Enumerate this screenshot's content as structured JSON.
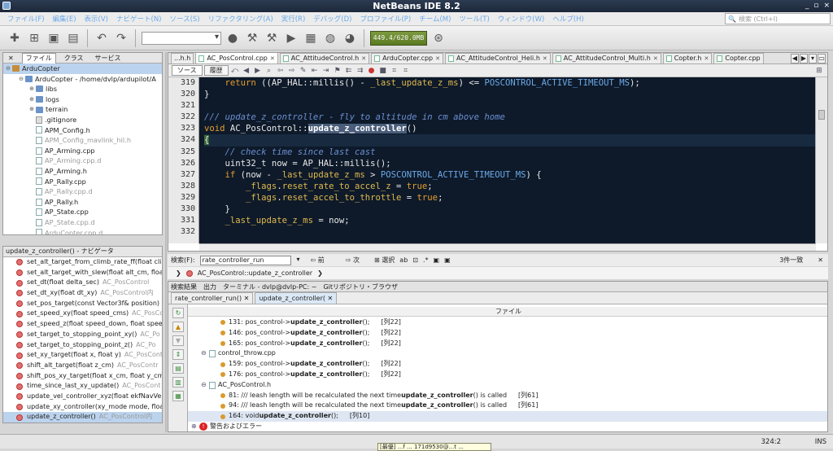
{
  "window": {
    "title": "NetBeans IDE 8.2",
    "controls": [
      "_",
      "▫",
      "×"
    ]
  },
  "menu": {
    "items": [
      "ファイル(F)",
      "編集(E)",
      "表示(V)",
      "ナビゲート(N)",
      "ソース(S)",
      "リファクタリング(A)",
      "実行(R)",
      "デバッグ(D)",
      "プロファイル(P)",
      "チーム(M)",
      "ツール(T)",
      "ウィンドウ(W)",
      "ヘルプ(H)"
    ],
    "search_placeholder": "検索 (Ctrl+I)"
  },
  "toolbar": {
    "memory": "449.4/620.0MB"
  },
  "project": {
    "tabs": [
      "ファイル",
      "クラス",
      "サービス"
    ],
    "root": "ArduCopter",
    "project_node": "ArduCopter - /home/dvlp/ardupilot/A",
    "items": [
      {
        "label": "libs",
        "kind": "folder",
        "dim": false
      },
      {
        "label": "logs",
        "kind": "folder",
        "dim": false
      },
      {
        "label": "terrain",
        "kind": "folder",
        "dim": false
      },
      {
        "label": ".gitignore",
        "kind": "git",
        "dim": false
      },
      {
        "label": "APM_Config.h",
        "kind": "file",
        "dim": false
      },
      {
        "label": "APM_Config_mavlink_hil.h",
        "kind": "file",
        "dim": true
      },
      {
        "label": "AP_Arming.cpp",
        "kind": "file",
        "dim": false
      },
      {
        "label": "AP_Arming.cpp.d",
        "kind": "file",
        "dim": true
      },
      {
        "label": "AP_Arming.h",
        "kind": "file",
        "dim": false
      },
      {
        "label": "AP_Rally.cpp",
        "kind": "file",
        "dim": false
      },
      {
        "label": "AP_Rally.cpp.d",
        "kind": "file",
        "dim": true
      },
      {
        "label": "AP_Rally.h",
        "kind": "file",
        "dim": false
      },
      {
        "label": "AP_State.cpp",
        "kind": "file",
        "dim": false
      },
      {
        "label": "AP_State.cpp.d",
        "kind": "file",
        "dim": true
      },
      {
        "label": "ArduCopter.cpp.d",
        "kind": "file",
        "dim": true
      }
    ]
  },
  "navigator": {
    "title": "update_z_controller() - ナビゲータ",
    "items": [
      {
        "sig": "set_alt_target_from_climb_rate_ff(float clim",
        "cls": ""
      },
      {
        "sig": "set_alt_target_with_slew(float alt_cm, float",
        "cls": ""
      },
      {
        "sig": "set_dt(float delta_sec)",
        "cls": "AC_PosControl"
      },
      {
        "sig": "set_dt_xy(float dt_xy)",
        "cls": "AC_PosControl内"
      },
      {
        "sig": "set_pos_target(const Vector3f& position)",
        "cls": ""
      },
      {
        "sig": "set_speed_xy(float speed_cms)",
        "cls": "AC_PosCo"
      },
      {
        "sig": "set_speed_z(float speed_down, float speed",
        "cls": ""
      },
      {
        "sig": "set_target_to_stopping_point_xy()",
        "cls": "AC_Po"
      },
      {
        "sig": "set_target_to_stopping_point_z()",
        "cls": "AC_Po"
      },
      {
        "sig": "set_xy_target(float x, float y)",
        "cls": "AC_PosContr"
      },
      {
        "sig": "shift_alt_target(float z_cm)",
        "cls": "AC_PosContr"
      },
      {
        "sig": "shift_pos_xy_target(float x_cm, float y_cm)",
        "cls": ""
      },
      {
        "sig": "time_since_last_xy_update()",
        "cls": "AC_PosCont"
      },
      {
        "sig": "update_vel_controller_xyz(float ekfNavVelG",
        "cls": ""
      },
      {
        "sig": "update_xy_controller(xy_mode mode, float",
        "cls": ""
      },
      {
        "sig": "update_z_controller()",
        "cls": "AC_PosControl内"
      }
    ]
  },
  "editor": {
    "tabs": [
      "...h.h",
      "AC_PosControl.cpp",
      "AC_AttitudeControl.h",
      "ArduCopter.cpp",
      "AC_AttitudeControl_Heli.h",
      "AC_AttitudeControl_Multi.h",
      "Copter.h",
      "Copter.cpp"
    ],
    "mode_source": "ソース",
    "mode_history": "履歴",
    "line_numbers": [
      "319",
      "320",
      "321",
      "322",
      "323",
      "324",
      "325",
      "326",
      "327",
      "328",
      "329",
      "330",
      "331",
      "332"
    ]
  },
  "find": {
    "label": "検索(F):",
    "value": "rate_controller_run",
    "prev": "前",
    "next": "次",
    "select": "選択",
    "count": "3件一致"
  },
  "breadcrumb": {
    "item": "AC_PosControl::update_z_controller"
  },
  "output": {
    "tabs": [
      "検索結果",
      "出力",
      "ターミナル - dvlp@dvlp-PC: ~",
      "Gitリポジトリ・ブラウザ"
    ],
    "subtabs": [
      "rate_controller_run()",
      "update_z_controller("
    ],
    "header": "ファイル",
    "results": [
      {
        "type": "hit",
        "line": "131:",
        "pre": "pos_control->",
        "bold": "update_z_controller",
        "post": "();",
        "col": "[列22]"
      },
      {
        "type": "hit",
        "line": "146:",
        "pre": "pos_control->",
        "bold": "update_z_controller",
        "post": "();",
        "col": "[列22]"
      },
      {
        "type": "hit",
        "line": "165:",
        "pre": "pos_control->",
        "bold": "update_z_controller",
        "post": "();",
        "col": "[列22]"
      },
      {
        "type": "file",
        "name": "control_throw.cpp"
      },
      {
        "type": "hit",
        "line": "159:",
        "pre": "pos_control->",
        "bold": "update_z_controller",
        "post": "();",
        "col": "[列22]"
      },
      {
        "type": "hit",
        "line": "176:",
        "pre": "pos_control->",
        "bold": "update_z_controller",
        "post": "();",
        "col": "[列22]"
      },
      {
        "type": "file",
        "name": "AC_PosControl.h"
      },
      {
        "type": "hit",
        "line": "81:",
        "pre": "///     leash length will be recalculated the next time ",
        "bold": "update_z_controller",
        "post": "() is called",
        "col": "[列61]"
      },
      {
        "type": "hit",
        "line": "94:",
        "pre": "///     leash length will be recalculated the next time ",
        "bold": "update_z_controller",
        "post": "() is called",
        "col": "[列61]"
      },
      {
        "type": "hit",
        "line": "164:",
        "pre": "void ",
        "bold": "update_z_controller",
        "post": "();",
        "col": "[列10]",
        "sel": true
      },
      {
        "type": "error",
        "name": "警告およびエラー"
      }
    ]
  },
  "status": {
    "position": "324:2",
    "mode": "INS",
    "tooltip": "[最優]  ...f ... 171d9530@...t ... "
  }
}
